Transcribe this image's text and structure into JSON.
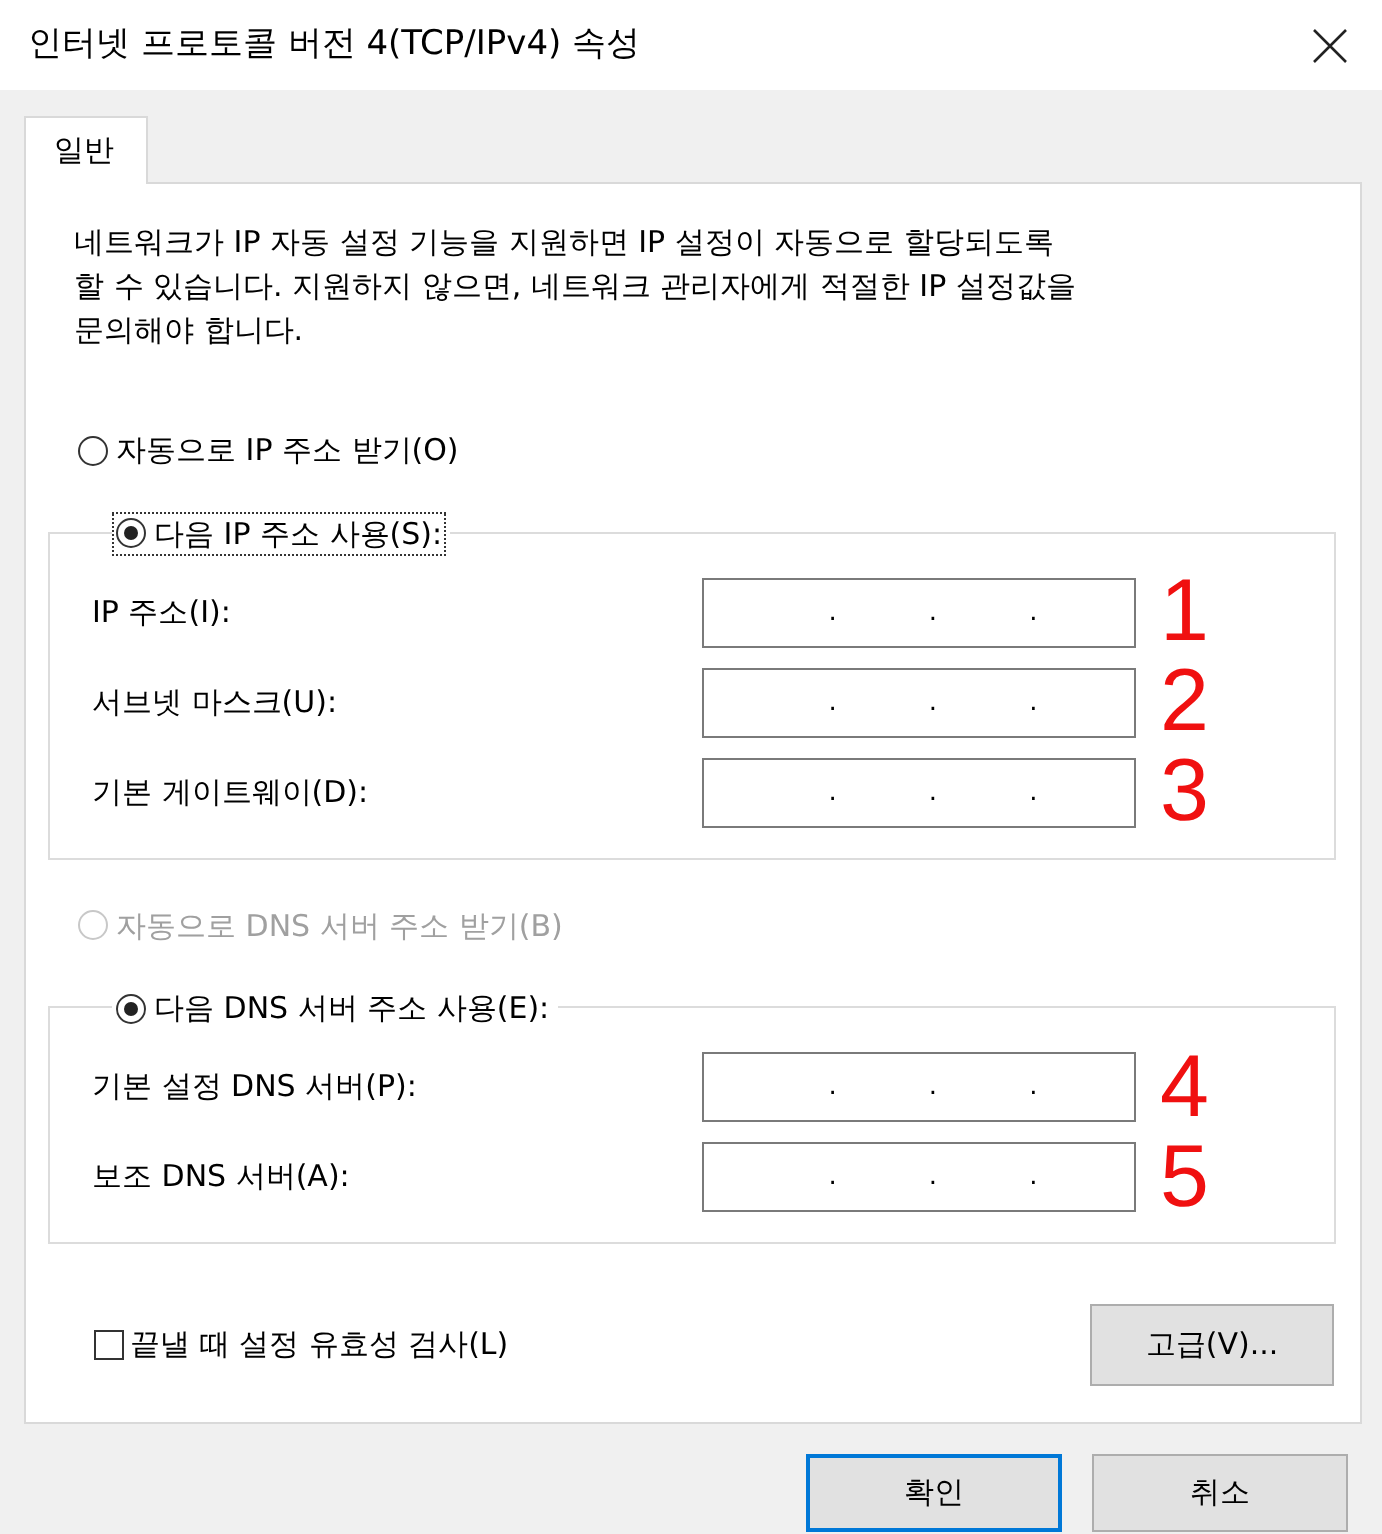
{
  "window": {
    "title": "인터넷 프로토콜 버전 4(TCP/IPv4) 속성"
  },
  "tabs": [
    {
      "label": "일반",
      "selected": true
    }
  ],
  "description": "네트워크가 IP 자동 설정 기능을 지원하면 IP 설정이 자동으로 할당되도록\n할 수 있습니다. 지원하지 않으면, 네트워크 관리자에게 적절한 IP 설정값을\n문의해야 합니다.",
  "ip_section": {
    "auto_option": {
      "label": "자동으로 IP 주소 받기(O)",
      "selected": false,
      "disabled": false,
      "focused": false
    },
    "manual_option": {
      "label": "다음 IP 주소 사용(S):",
      "selected": true,
      "disabled": false,
      "focused": true
    },
    "fields": [
      {
        "label": "IP 주소(I):",
        "separator": ".",
        "annotation": "1"
      },
      {
        "label": "서브넷 마스크(U):",
        "separator": ".",
        "annotation": "2"
      },
      {
        "label": "기본 게이트웨이(D):",
        "separator": ".",
        "annotation": "3"
      }
    ]
  },
  "dns_section": {
    "auto_option": {
      "label": "자동으로 DNS 서버 주소 받기(B)",
      "selected": false,
      "disabled": true,
      "focused": false
    },
    "manual_option": {
      "label": "다음 DNS 서버 주소 사용(E):",
      "selected": true,
      "disabled": false,
      "focused": false
    },
    "fields": [
      {
        "label": "기본 설정 DNS 서버(P):",
        "separator": ".",
        "annotation": "4"
      },
      {
        "label": "보조 DNS 서버(A):",
        "separator": ".",
        "annotation": "5"
      }
    ]
  },
  "validate_checkbox": {
    "label": "끝낼 때 설정 유효성 검사(L)",
    "checked": false
  },
  "advanced_button": "고급(V)...",
  "buttons": [
    {
      "label": "확인",
      "default": true
    },
    {
      "label": "취소",
      "default": false
    }
  ]
}
